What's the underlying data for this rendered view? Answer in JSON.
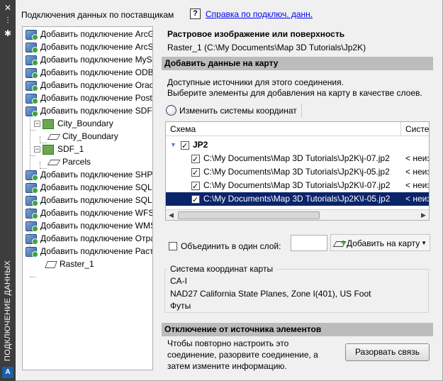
{
  "window": {
    "vertical_title": "ПОДКЛЮЧЕНИЕ ДАННЫХ",
    "close_glyph": "✕",
    "pin_glyph": "⫶",
    "settings_glyph": "✱",
    "logo": "A"
  },
  "left": {
    "heading": "Подключения данных по поставщикам",
    "tree": [
      {
        "label": "Добавить подключение ArcGIS",
        "icon": "provider-icon",
        "level": 0
      },
      {
        "label": "Добавить подключение ArcSDE",
        "icon": "provider-icon",
        "level": 0
      },
      {
        "label": "Добавить подключение MySQL",
        "icon": "provider-icon",
        "level": 0
      },
      {
        "label": "Добавить подключение ODBC",
        "icon": "provider-icon",
        "level": 0
      },
      {
        "label": "Добавить подключение Oracle",
        "icon": "provider-icon",
        "level": 0
      },
      {
        "label": "Добавить подключение PostGIS",
        "icon": "provider-icon",
        "level": 0
      },
      {
        "label": "Добавить подключение SDF",
        "icon": "provider-icon",
        "level": 0
      },
      {
        "label": "City_Boundary",
        "icon": "layer-icon",
        "level": 1,
        "expand": "−"
      },
      {
        "label": "City_Boundary",
        "icon": "feature-class-icon",
        "level": 2
      },
      {
        "label": "SDF_1",
        "icon": "layer-icon",
        "level": 1,
        "expand": "−"
      },
      {
        "label": "Parcels",
        "icon": "feature-class-icon",
        "level": 2
      },
      {
        "label": "Добавить подключение SHP",
        "icon": "provider-icon",
        "level": 0
      },
      {
        "label": "Добавить подключение SQL Server",
        "icon": "provider-icon",
        "level": 0
      },
      {
        "label": "Добавить подключение SQLite",
        "icon": "provider-icon",
        "level": 0
      },
      {
        "label": "Добавить подключение WFS",
        "icon": "provider-icon",
        "level": 0
      },
      {
        "label": "Добавить подключение WMS",
        "icon": "provider-icon",
        "level": 0
      },
      {
        "label": "Добавить подключение Отражение",
        "icon": "provider-icon",
        "level": 0
      },
      {
        "label": "Добавить подключение Растр",
        "icon": "provider-icon",
        "level": 0
      },
      {
        "label": "Raster_1",
        "icon": "raster-icon",
        "level": 1
      }
    ]
  },
  "help": {
    "icon": "?",
    "link": "Справка по подключ. данн."
  },
  "right": {
    "title": "Растровое изображение или поверхность",
    "path": "Raster_1 (C:\\My Documents\\Map 3D Tutorials\\Jp2K)",
    "add_section": "Добавить данные на карту",
    "desc_line1": "Доступные источники для этого соединения.",
    "desc_line2": "Выберите элементы для добавления на карту в качестве слоев.",
    "change_cs": "Изменить системы координат",
    "grid": {
      "col_schema": "Схема",
      "col_cs": "Система координат",
      "group": "JP2",
      "rows": [
        {
          "path": "C:\\My Documents\\Map 3D Tutorials\\Jp2K\\j-07.jp2",
          "cs": "< неизвестно >",
          "selected": false
        },
        {
          "path": "C:\\My Documents\\Map 3D Tutorials\\Jp2K\\j-05.jp2",
          "cs": "< неизвестно >",
          "selected": false
        },
        {
          "path": "C:\\My Documents\\Map 3D Tutorials\\Jp2K\\I-07.jp2",
          "cs": "< неизвестно >",
          "selected": false
        },
        {
          "path": "C:\\My Documents\\Map 3D Tutorials\\Jp2K\\I-05.jp2",
          "cs": "< неизвестно >",
          "selected": true
        }
      ]
    },
    "merge_label": "Объединить в один слой:",
    "merge_value": "",
    "add_button": "Добавить на карту",
    "cs_group": {
      "legend": "Система координат карты",
      "code": "CA-I",
      "name": "NAD27 California State Planes, Zone I(401), US Foot",
      "units": "Футы"
    },
    "disconnect_section": "Отключение от источника элементов",
    "disc_line1": "Чтобы повторно настроить это",
    "disc_line2": "соединение, разорвите соединение, а",
    "disc_line3": "затем измените информацию.",
    "disconnect_button": "Разорвать связь"
  }
}
